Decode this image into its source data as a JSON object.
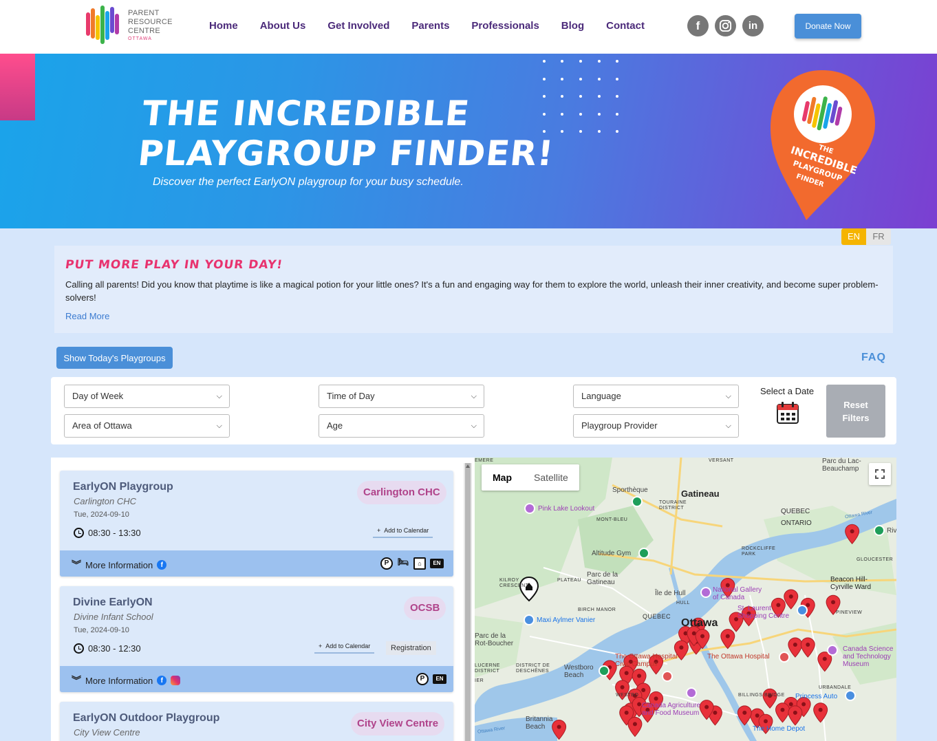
{
  "header": {
    "logo_line1": "PARENT",
    "logo_line2": "RESOURCE",
    "logo_line3": "CENTRE",
    "logo_sub": "OTTAWA",
    "nav": [
      "Home",
      "About Us",
      "Get Involved",
      "Parents",
      "Professionals",
      "Blog",
      "Contact"
    ],
    "social": [
      "facebook-icon",
      "instagram-icon",
      "linkedin-icon"
    ],
    "donate_label": "Donate Now"
  },
  "hero": {
    "title_line1": "THE INCREDIBLE",
    "title_line2": "PLAYGROUP FINDER!",
    "subtitle": "Discover the perfect EarlyON playgroup for your busy schedule.",
    "badge_line1": "THE",
    "badge_line2": "INCREDIBLE",
    "badge_line3": "PLAYGROUP",
    "badge_line4": "FINDER"
  },
  "lang": {
    "en": "EN",
    "fr": "FR",
    "active": "EN"
  },
  "intro": {
    "heading": "PUT MORE PLAY IN YOUR DAY!",
    "text": "Calling all parents! Did you know that playtime is like a magical potion for your little ones? It's a fun and engaging way for them to explore the world, unleash their inner creativity, and become super problem-solvers!",
    "read_more": "Read More"
  },
  "actions": {
    "today_label": "Show Today's Playgroups",
    "faq_label": "FAQ"
  },
  "filters": {
    "day_of_week": "Day of Week",
    "time_of_day": "Time of Day",
    "language": "Language",
    "area": "Area of Ottawa",
    "age": "Age",
    "provider": "Playgroup Provider",
    "date_label": "Select a Date",
    "reset_line1": "Reset",
    "reset_line2": "Filters"
  },
  "playgroups": [
    {
      "name": "EarlyON Playgroup",
      "location": "Carlington CHC",
      "date": "Tue, 2024-09-10",
      "time": "08:30 - 13:30",
      "provider": "Carlington CHC",
      "add_calendar": "Add to Calendar",
      "registration": "",
      "more_info": "More Information"
    },
    {
      "name": "Divine EarlyON",
      "location": "Divine Infant School",
      "date": "Tue, 2024-09-10",
      "time": "08:30 - 12:30",
      "provider": "OCSB",
      "add_calendar": "Add to Calendar",
      "registration": "Registration",
      "more_info": "More Information"
    },
    {
      "name": "EarlyON Outdoor Playgroup",
      "location": "City View Centre",
      "provider": "City View Centre"
    }
  ],
  "feature_icons": {
    "parking": "P",
    "language_en": "EN"
  },
  "map": {
    "tab_map": "Map",
    "tab_satellite": "Satellite",
    "labels": {
      "gatineau": "Gatineau",
      "ottawa": "Ottawa",
      "sportheque": "Sporthèque",
      "pink_lake": "Pink Lake Lookout",
      "altitude": "Altitude Gym",
      "parc_gatineau": "Parc de la Gatineau",
      "ile_hull": "Île de Hull",
      "maxi": "Maxi Aylmer Vanier",
      "national_gallery": "National Gallery of Canada",
      "st_laurent": "St. Laurent Shopping Centre",
      "ottawa_hospital": "The Ottawa Hospital",
      "civic": "The Ottawa Hospital Civic Campus",
      "agriculture": "Canada Agriculture and Food Museum",
      "science": "Canada Science and Technology Museum",
      "beacon": "Beacon Hill-Cyrville Ward",
      "quebec": "QUEBEC",
      "ontario": "ONTARIO",
      "westboro": "Westboro Beach",
      "britannia": "Britannia Beach",
      "home_depot": "The Home Depot",
      "parc_lac": "Parc du Lac-Beauchamp",
      "parc_rot": "Parc de la Rot-Boucher",
      "princess_auto": "Princess Auto",
      "riv": "Riv",
      "versant": "VERSANT",
      "emere": "EMERE",
      "touraine": "TOURAINE DISTRICT",
      "mont_bleu": "MONT-BLEU",
      "rockcliffe": "ROCKCLIFFE PARK",
      "gloucester": "GLOUCESTER",
      "kilroy": "KILROY CRESCENT",
      "plateau": "PLATEAU",
      "birch": "BIRCH MANOR",
      "quebec2": "QUEBEC",
      "hull": "HULL",
      "district_deschenes": "DISTRICT DE DESCHÊNES",
      "lucerne": "LUCERNE DISTRICT",
      "ier": "IER",
      "westbo": "WESTBO",
      "billings": "BILLINGS BRIDGE",
      "urbandale": "URBANDALE",
      "pineview": "PINEVIEW",
      "ottawa_river": "Ottawa River",
      "ottawa_river2": "Ottawa River"
    },
    "pins": [
      [
        0.895,
        0.27
      ],
      [
        0.6,
        0.46
      ],
      [
        0.72,
        0.53
      ],
      [
        0.75,
        0.5
      ],
      [
        0.65,
        0.56
      ],
      [
        0.62,
        0.58
      ],
      [
        0.53,
        0.6
      ],
      [
        0.5,
        0.63
      ],
      [
        0.6,
        0.64
      ],
      [
        0.525,
        0.66
      ],
      [
        0.49,
        0.68
      ],
      [
        0.43,
        0.73
      ],
      [
        0.37,
        0.73
      ],
      [
        0.32,
        0.75
      ],
      [
        0.36,
        0.77
      ],
      [
        0.39,
        0.78
      ],
      [
        0.35,
        0.82
      ],
      [
        0.4,
        0.83
      ],
      [
        0.38,
        0.85
      ],
      [
        0.43,
        0.86
      ],
      [
        0.37,
        0.9
      ],
      [
        0.39,
        0.88
      ],
      [
        0.36,
        0.91
      ],
      [
        0.7,
        0.85
      ],
      [
        0.75,
        0.88
      ],
      [
        0.78,
        0.88
      ],
      [
        0.73,
        0.9
      ],
      [
        0.67,
        0.92
      ],
      [
        0.64,
        0.91
      ],
      [
        0.69,
        0.94
      ],
      [
        0.83,
        0.72
      ],
      [
        0.76,
        0.67
      ],
      [
        0.79,
        0.67
      ],
      [
        0.85,
        0.52
      ],
      [
        0.79,
        0.53
      ],
      [
        0.82,
        0.9
      ],
      [
        0.76,
        0.91
      ],
      [
        0.38,
        0.95
      ],
      [
        0.2,
        0.96
      ],
      [
        0.41,
        0.9
      ],
      [
        0.57,
        0.91
      ],
      [
        0.55,
        0.89
      ],
      [
        0.52,
        0.63
      ],
      [
        0.54,
        0.64
      ]
    ]
  }
}
